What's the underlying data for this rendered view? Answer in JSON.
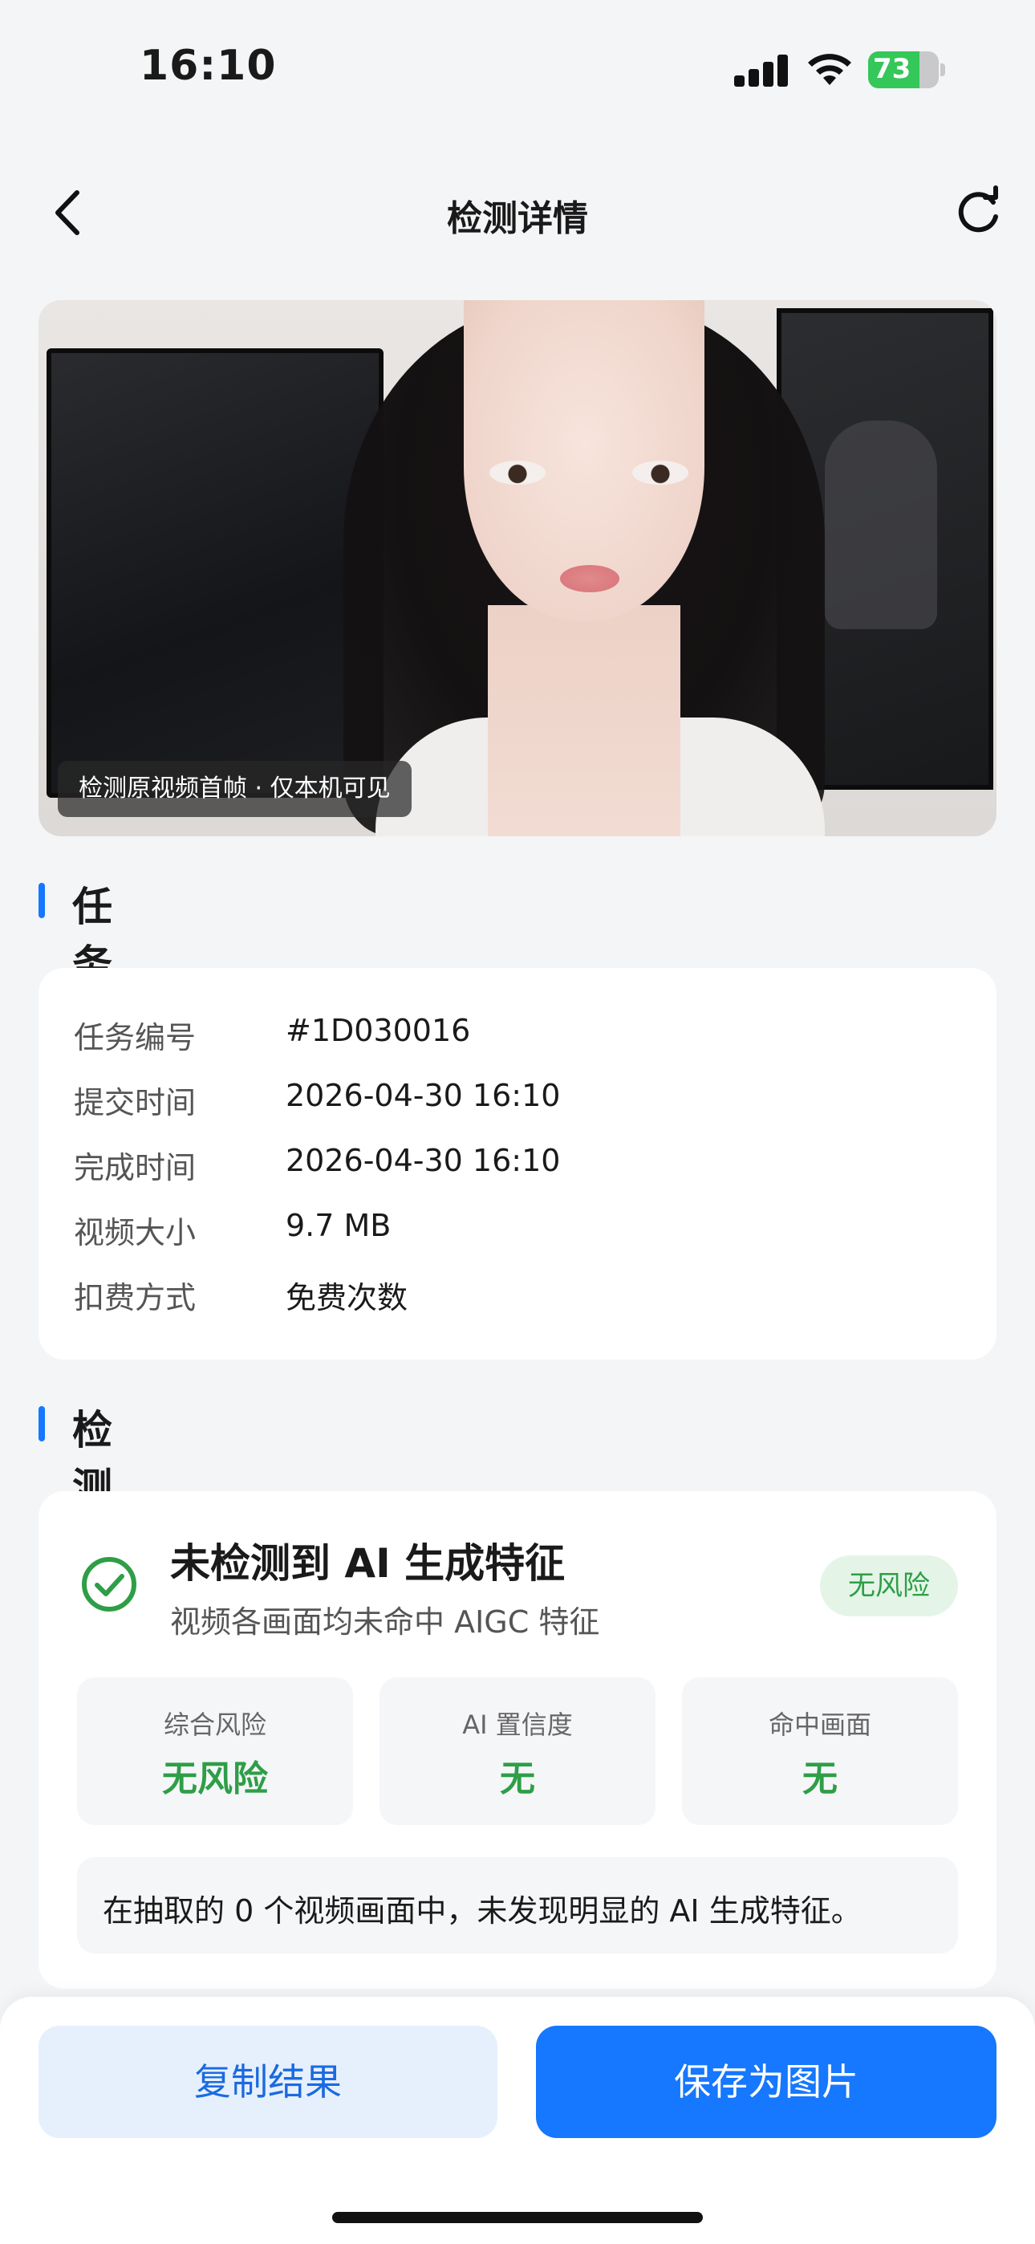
{
  "status_bar": {
    "time": "16:10",
    "battery_percent": 73,
    "battery_label": "73",
    "icons": [
      "signal-icon",
      "wifi-icon",
      "battery-icon"
    ]
  },
  "nav": {
    "title": "检测详情",
    "back_icon": "chevron-left-icon",
    "refresh_icon": "refresh-icon"
  },
  "video": {
    "caption": "检测原视频首帧 · 仅本机可见"
  },
  "task_info": {
    "section_title": "任务信息",
    "rows": [
      {
        "label": "任务编号",
        "value": "#1D030016"
      },
      {
        "label": "提交时间",
        "value": "2026-04-30 16:10"
      },
      {
        "label": "完成时间",
        "value": "2026-04-30 16:10"
      },
      {
        "label": "视频大小",
        "value": "9.7 MB"
      },
      {
        "label": "扣费方式",
        "value": "免费次数"
      }
    ]
  },
  "result": {
    "section_title": "检测结果",
    "title": "未检测到 AI 生成特征",
    "subtitle": "视频各画面均未命中 AIGC 特征",
    "badge": "无风险",
    "metrics": [
      {
        "label": "综合风险",
        "value": "无风险"
      },
      {
        "label": "AI 置信度",
        "value": "无"
      },
      {
        "label": "命中画面",
        "value": "无"
      }
    ],
    "summary": "在抽取的 0 个视频画面中，未发现明显的 AI 生成特征。",
    "accent_color": "#2e9e47"
  },
  "actions": {
    "copy_label": "复制结果",
    "save_label": "保存为图片",
    "primary_color": "#1677ff"
  }
}
